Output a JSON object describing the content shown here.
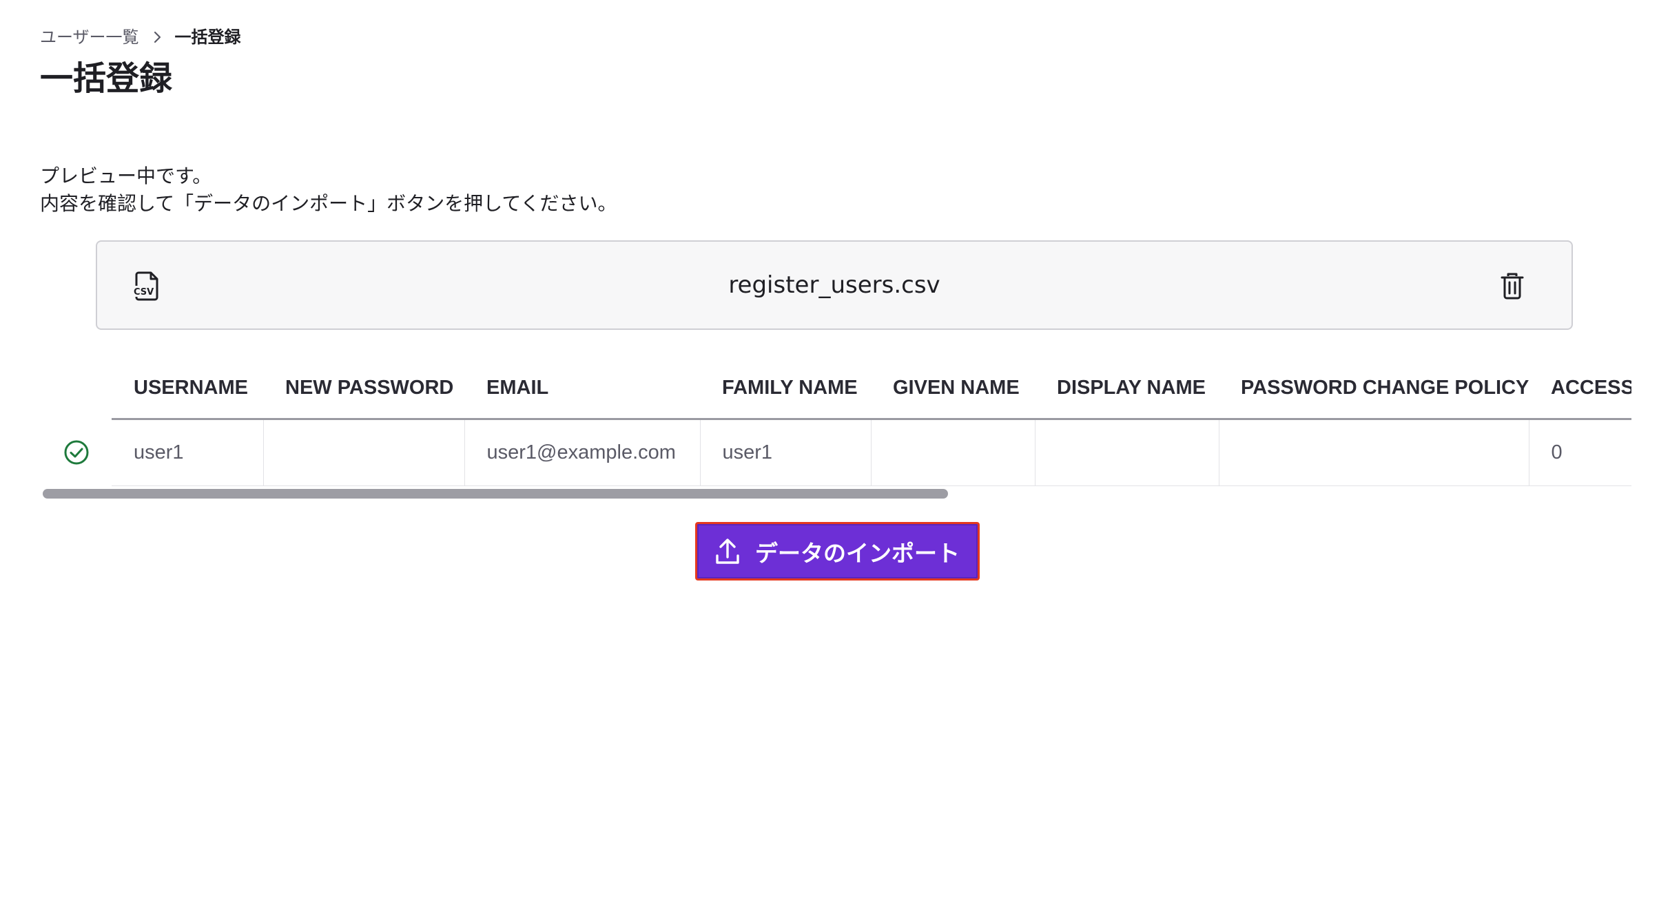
{
  "breadcrumb": {
    "parent_label": "ユーザー一覧",
    "current_label": "一括登録"
  },
  "page": {
    "title": "一括登録"
  },
  "intro": {
    "line1": "プレビュー中です。",
    "line2": "内容を確認して「データのインポート」ボタンを押してください。"
  },
  "file": {
    "name": "register_users.csv",
    "icon": "csv-file-icon",
    "delete_icon": "trash-icon"
  },
  "table": {
    "columns": [
      "USERNAME",
      "NEW PASSWORD",
      "EMAIL",
      "FAMILY NAME",
      "GIVEN NAME",
      "DISPLAY NAME",
      "PASSWORD CHANGE POLICY",
      "ACCESS F"
    ],
    "rows": [
      {
        "status_icon": "check-circle-icon",
        "cells": [
          "user1",
          "",
          "user1@example.com",
          "user1",
          "",
          "",
          "",
          "0"
        ]
      }
    ]
  },
  "scroll": {
    "visible_fraction": 0.57
  },
  "actions": {
    "import_label": "データのインポート",
    "import_icon": "upload-icon"
  },
  "colors": {
    "accent": "#6d2fd6",
    "focus_outline": "#e5391f",
    "success": "#1e7a3c"
  }
}
